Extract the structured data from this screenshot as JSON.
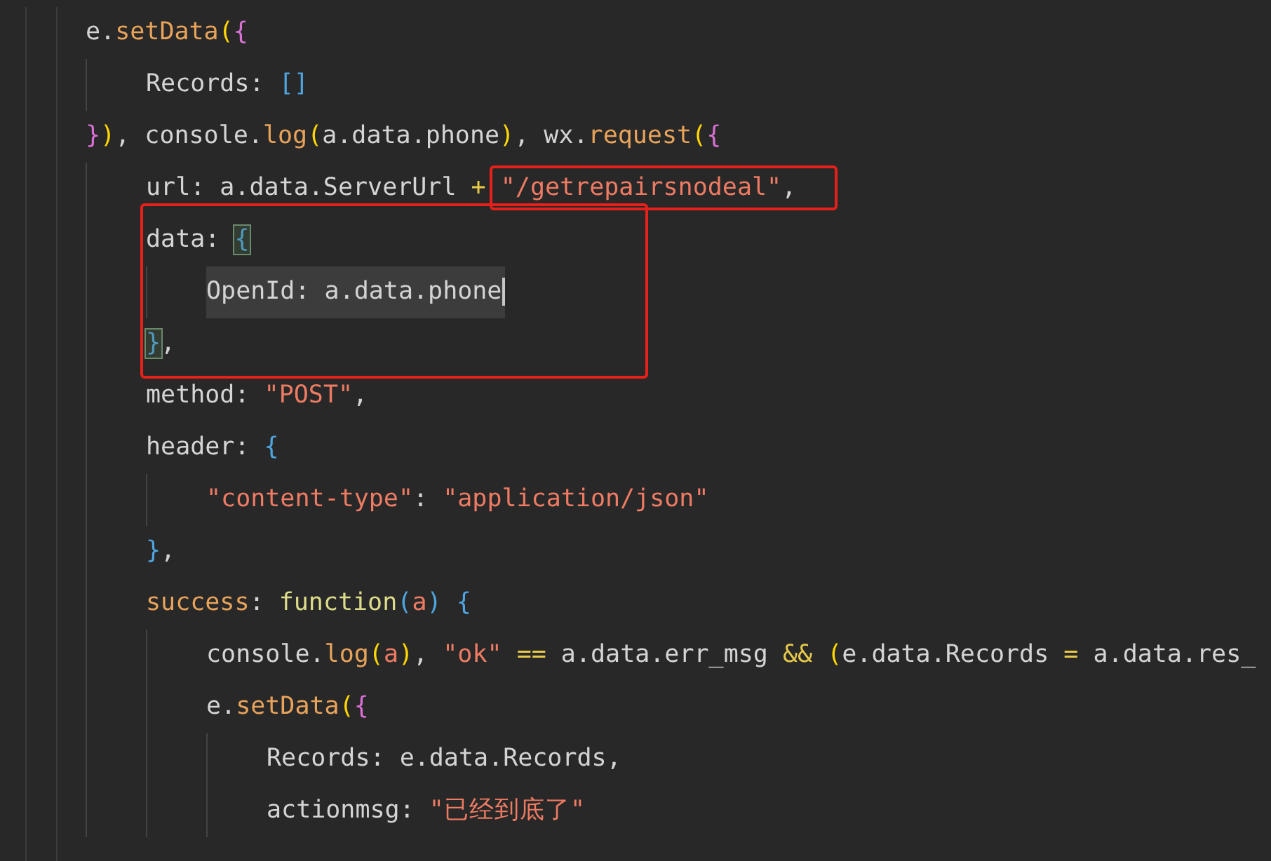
{
  "editor": {
    "lines": [
      {
        "tokens": [
          {
            "text": "e",
            "kind": "text"
          },
          {
            "text": ".",
            "kind": "text"
          },
          {
            "text": "setData",
            "kind": "fn"
          },
          {
            "text": "(",
            "kind": "br1"
          },
          {
            "text": "{",
            "kind": "br2"
          }
        ],
        "children": [
          {
            "tokens": [
              {
                "text": "Records",
                "kind": "text"
              },
              {
                "text": ": ",
                "kind": "text"
              },
              {
                "text": "[]",
                "kind": "br3"
              }
            ]
          }
        ],
        "close": [
          {
            "text": "}",
            "kind": "br2"
          },
          {
            "text": ")",
            "kind": "br1"
          },
          {
            "text": ", console.",
            "kind": "text"
          },
          {
            "text": "log",
            "kind": "fn"
          },
          {
            "text": "(",
            "kind": "br1"
          },
          {
            "text": "a.data.phone",
            "kind": "text"
          },
          {
            "text": ")",
            "kind": "br1"
          },
          {
            "text": ", wx.",
            "kind": "text"
          },
          {
            "text": "request",
            "kind": "fn"
          },
          {
            "text": "(",
            "kind": "br1"
          },
          {
            "text": "{",
            "kind": "br2"
          }
        ]
      },
      {
        "children": [
          {
            "tokens": [
              {
                "text": "url: a.data.ServerUrl ",
                "kind": "text"
              },
              {
                "text": "+ ",
                "kind": "op"
              },
              {
                "text": "\"/getrepairsnodeal\"",
                "kind": "str",
                "boxed": true
              },
              {
                "text": ",",
                "kind": "text"
              }
            ]
          },
          {
            "boxed": true,
            "tokens": [
              {
                "text": "data: ",
                "kind": "text"
              },
              {
                "text": "{",
                "kind": "br3",
                "matched": true
              }
            ],
            "children": [
              {
                "current": true,
                "tokens": [
                  {
                    "text": "OpenId: a.data.phone",
                    "kind": "text"
                  }
                ]
              }
            ],
            "close": [
              {
                "text": "}",
                "kind": "br3",
                "matched": true
              },
              {
                "text": ",",
                "kind": "text"
              }
            ]
          },
          {
            "tokens": [
              {
                "text": "method: ",
                "kind": "text"
              },
              {
                "text": "\"POST\"",
                "kind": "str"
              },
              {
                "text": ",",
                "kind": "text"
              }
            ]
          },
          {
            "tokens": [
              {
                "text": "header: ",
                "kind": "text"
              },
              {
                "text": "{",
                "kind": "br3"
              }
            ],
            "children": [
              {
                "tokens": [
                  {
                    "text": "\"content-type\"",
                    "kind": "str"
                  },
                  {
                    "text": ": ",
                    "kind": "text"
                  },
                  {
                    "text": "\"application/json\"",
                    "kind": "str"
                  }
                ]
              }
            ],
            "close": [
              {
                "text": "}",
                "kind": "br3"
              },
              {
                "text": ",",
                "kind": "text"
              }
            ]
          },
          {
            "tokens": [
              {
                "text": "success",
                "kind": "key"
              },
              {
                "text": ": ",
                "kind": "text"
              },
              {
                "text": "function",
                "kind": "kw"
              },
              {
                "text": "(",
                "kind": "br3"
              },
              {
                "text": "a",
                "kind": "param"
              },
              {
                "text": ")",
                "kind": "br3"
              },
              {
                "text": " {",
                "kind": "br3"
              }
            ],
            "children": [
              {
                "tokens": [
                  {
                    "text": "console.",
                    "kind": "text"
                  },
                  {
                    "text": "log",
                    "kind": "fn"
                  },
                  {
                    "text": "(",
                    "kind": "br1"
                  },
                  {
                    "text": "a",
                    "kind": "param"
                  },
                  {
                    "text": ")",
                    "kind": "br1"
                  },
                  {
                    "text": ", ",
                    "kind": "text"
                  },
                  {
                    "text": "\"ok\"",
                    "kind": "str"
                  },
                  {
                    "text": " ==",
                    "kind": "op"
                  },
                  {
                    "text": " a.data.err_msg ",
                    "kind": "text"
                  },
                  {
                    "text": "&& ",
                    "kind": "op"
                  },
                  {
                    "text": "(",
                    "kind": "br1"
                  },
                  {
                    "text": "e.data.Records ",
                    "kind": "text"
                  },
                  {
                    "text": "=",
                    "kind": "op"
                  },
                  {
                    "text": " a.data.res_",
                    "kind": "text"
                  }
                ]
              },
              {
                "tokens": [
                  {
                    "text": "e.",
                    "kind": "text"
                  },
                  {
                    "text": "setData",
                    "kind": "fn"
                  },
                  {
                    "text": "(",
                    "kind": "br1"
                  },
                  {
                    "text": "{",
                    "kind": "br2"
                  }
                ],
                "children": [
                  {
                    "tokens": [
                      {
                        "text": "Records: e.data.Records,",
                        "kind": "text"
                      }
                    ]
                  },
                  {
                    "tokens": [
                      {
                        "text": "actionmsg: ",
                        "kind": "text"
                      },
                      {
                        "text": "\"已经到底了\"",
                        "kind": "str"
                      }
                    ]
                  }
                ]
              }
            ]
          }
        ]
      }
    ]
  }
}
